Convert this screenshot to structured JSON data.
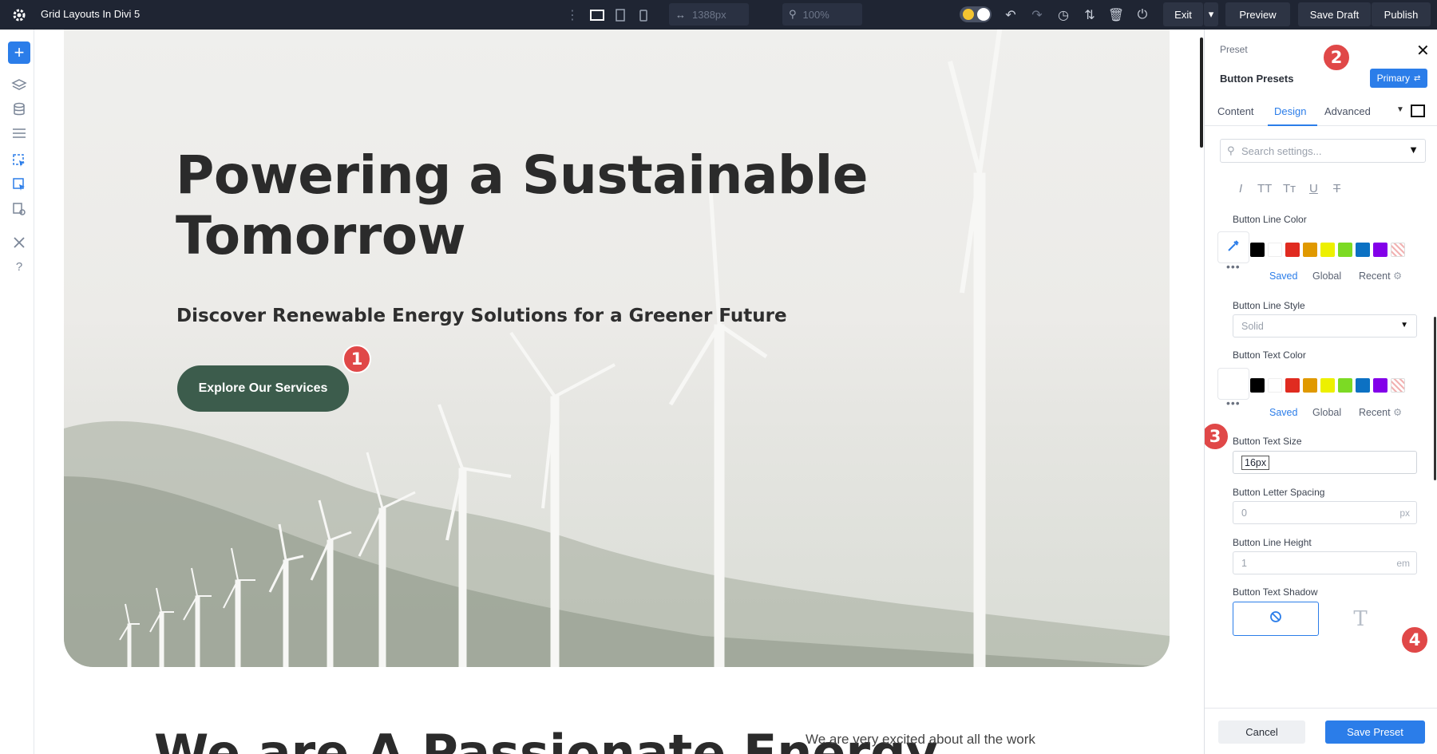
{
  "topbar": {
    "title": "Grid Layouts In Divi 5",
    "width_value": "1388px",
    "zoom_value": "100%",
    "exit_label": "Exit",
    "preview_label": "Preview",
    "save_draft_label": "Save Draft",
    "publish_label": "Publish"
  },
  "hero": {
    "title_line1": "Powering a Sustainable",
    "title_line2": "Tomorrow",
    "subtitle": "Discover Renewable Energy Solutions for a Greener Future",
    "button_label": "Explore Our Services"
  },
  "below": {
    "title": "We are A Passionate Energy",
    "text": "We are very excited about all the work"
  },
  "badges": [
    "1",
    "2",
    "3",
    "4"
  ],
  "panel": {
    "label": "Preset",
    "title": "Button Presets",
    "preset_badge": "Primary",
    "tabs": [
      "Content",
      "Design",
      "Advanced"
    ],
    "active_tab": "Design",
    "search_placeholder": "Search settings...",
    "line_color_label": "Button Line Color",
    "line_style_label": "Button Line Style",
    "line_style_value": "Solid",
    "text_color_label": "Button Text Color",
    "palette_links": [
      "Saved",
      "Global",
      "Recent"
    ],
    "text_size_label": "Button Text Size",
    "text_size_value": "16px",
    "letter_spacing_label": "Button Letter Spacing",
    "letter_spacing_value": "0",
    "letter_spacing_unit": "px",
    "line_height_label": "Button Line Height",
    "line_height_value": "1",
    "line_height_unit": "em",
    "text_shadow_label": "Button Text Shadow",
    "cancel_label": "Cancel",
    "save_label": "Save Preset",
    "swatches": [
      "#000000",
      "#ffffff",
      "#e02b20",
      "#e09900",
      "#edf000",
      "#7cda24",
      "#0c71c3",
      "#8300e9"
    ],
    "accent_color": "#2b7de9",
    "badge_color": "#e04848"
  }
}
